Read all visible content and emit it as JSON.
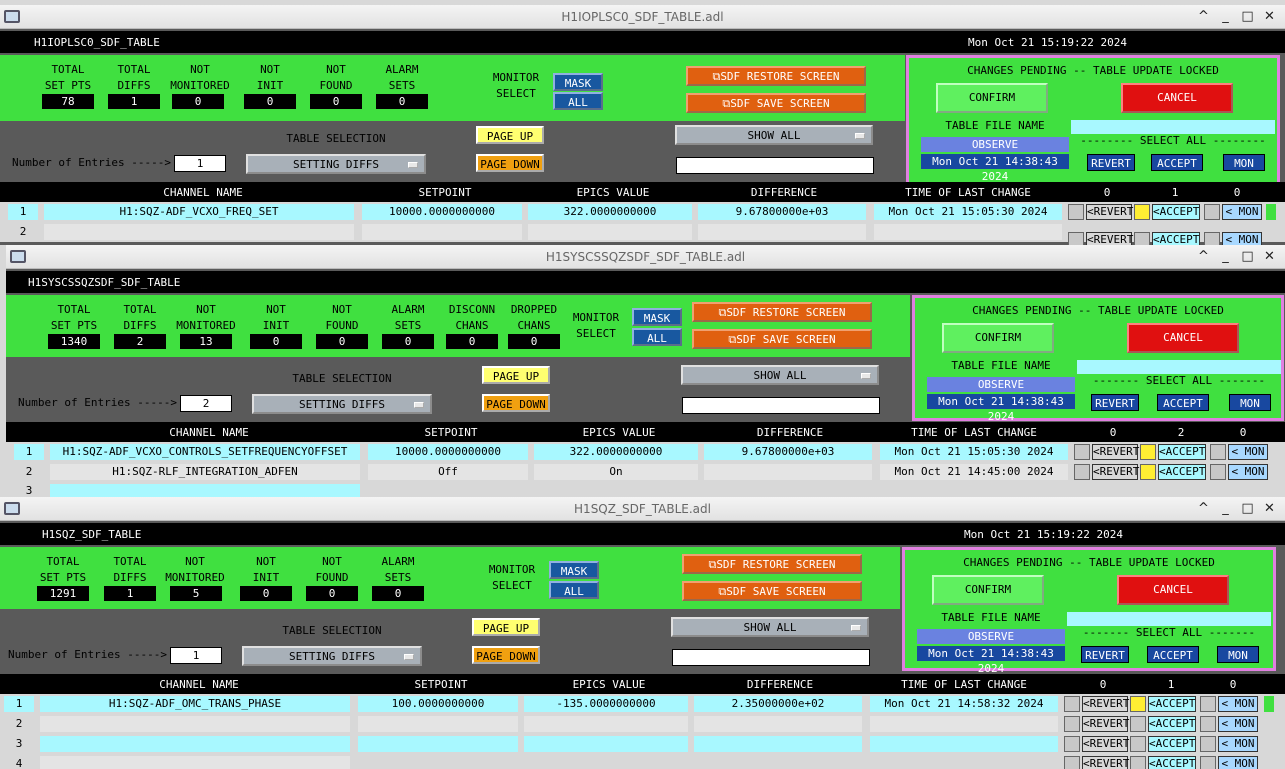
{
  "labels": {
    "total_set_pts": "TOTAL\nSET PTS",
    "total_diffs": "TOTAL\nDIFFS",
    "not_monitored": "NOT\nMONITORED",
    "not_init": "NOT\nINIT",
    "not_found": "NOT\nFOUND",
    "alarm_sets": "ALARM\nSETS",
    "disconn": "DISCONN\nCHANS",
    "dropped": "DROPPED\nCHANS",
    "monitor_select": "MONITOR\nSELECT",
    "mask": "MASK",
    "all": "ALL",
    "restore": "SDF RESTORE SCREEN",
    "save": "SDF SAVE SCREEN",
    "changes_pending": "CHANGES PENDING -- TABLE UPDATE LOCKED",
    "confirm": "CONFIRM",
    "cancel": "CANCEL",
    "table_file_name": "TABLE FILE NAME",
    "observe": "OBSERVE",
    "select_all": "-------- SELECT ALL --------",
    "select_all_b": "------- SELECT ALL -------",
    "revert": "REVERT",
    "accept": "ACCEPT",
    "mon": "MON",
    "table_selection": "TABLE SELECTION",
    "page_up": "PAGE UP",
    "page_down": "PAGE DOWN",
    "show_all": "SHOW ALL",
    "num_entries": "Number of Entries ----->",
    "setting_diffs": "SETTING DIFFS",
    "col_channel": "CHANNEL NAME",
    "col_setpoint": "SETPOINT",
    "col_epics": "EPICS VALUE",
    "col_diff": "DIFFERENCE",
    "col_time": "TIME OF LAST CHANGE",
    "r_revert": "<REVERT",
    "r_accept": "<ACCEPT",
    "r_mon": "< MON",
    "file_date": "Mon Oct 21 14:38:43 2024"
  },
  "w1": {
    "title": "H1IOPLSC0_SDF_TABLE.adl",
    "name": "H1IOPLSC0_SDF_TABLE",
    "time": "Mon Oct 21 15:19:22 2024",
    "total": "78",
    "diffs": "1",
    "notmon": "0",
    "notinit": "0",
    "notfound": "0",
    "alarm": "0",
    "entries": "1",
    "c0": "0",
    "c1": "1",
    "c2": "0",
    "rows": [
      {
        "n": "1",
        "ch": "H1:SQZ-ADF_VCXO_FREQ_SET",
        "sp": "10000.0000000000",
        "ev": "322.0000000000",
        "df": "9.67800000e+03",
        "tm": "Mon Oct 21 15:05:30 2024"
      },
      {
        "n": "2",
        "ch": "",
        "sp": "",
        "ev": "",
        "df": "",
        "tm": ""
      }
    ]
  },
  "w2": {
    "title": "H1SYSCSSQZSDF_SDF_TABLE.adl",
    "name": "H1SYSCSSQZSDF_SDF_TABLE",
    "total": "1340",
    "diffs": "2",
    "notmon": "13",
    "notinit": "0",
    "notfound": "0",
    "alarm": "0",
    "disconn": "0",
    "dropped": "0",
    "entries": "2",
    "c0": "0",
    "c1": "2",
    "c2": "0",
    "rows": [
      {
        "n": "1",
        "ch": "H1:SQZ-ADF_VCXO_CONTROLS_SETFREQUENCYOFFSET",
        "sp": "10000.0000000000",
        "ev": "322.0000000000",
        "df": "9.67800000e+03",
        "tm": "Mon Oct 21 15:05:30 2024"
      },
      {
        "n": "2",
        "ch": "H1:SQZ-RLF_INTEGRATION_ADFEN",
        "sp": "Off",
        "ev": "On",
        "df": "",
        "tm": "Mon Oct 21 14:45:00 2024"
      },
      {
        "n": "3",
        "ch": "",
        "sp": "",
        "ev": "",
        "df": "",
        "tm": ""
      }
    ]
  },
  "w3": {
    "title": "H1SQZ_SDF_TABLE.adl",
    "name": "H1SQZ_SDF_TABLE",
    "time": "Mon Oct 21 15:19:22 2024",
    "total": "1291",
    "diffs": "1",
    "notmon": "5",
    "notinit": "0",
    "notfound": "0",
    "alarm": "0",
    "entries": "1",
    "c0": "0",
    "c1": "1",
    "c2": "0",
    "rows": [
      {
        "n": "1",
        "ch": "H1:SQZ-ADF_OMC_TRANS_PHASE",
        "sp": "100.0000000000",
        "ev": "-135.0000000000",
        "df": "2.35000000e+02",
        "tm": "Mon Oct 21 14:58:32 2024"
      },
      {
        "n": "2",
        "ch": "",
        "sp": "",
        "ev": "",
        "df": "",
        "tm": ""
      },
      {
        "n": "3",
        "ch": "",
        "sp": "",
        "ev": "",
        "df": "",
        "tm": ""
      },
      {
        "n": "4",
        "ch": "",
        "sp": "",
        "ev": "",
        "df": "",
        "tm": ""
      }
    ]
  }
}
